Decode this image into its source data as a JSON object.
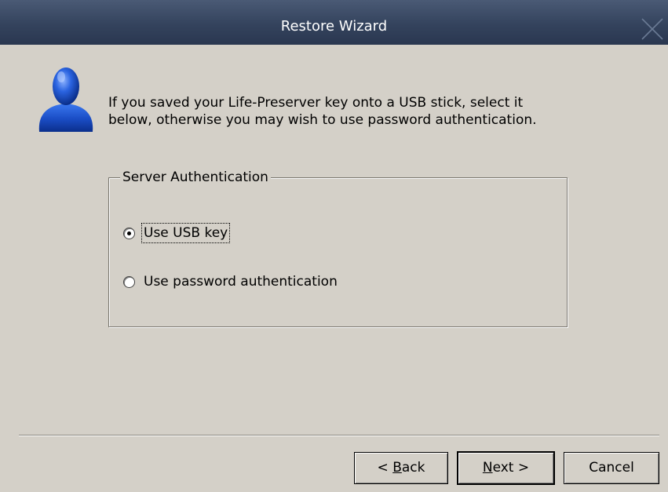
{
  "window": {
    "title": "Restore Wizard"
  },
  "intro": {
    "line1": "If you saved your Life-Preserver key onto a USB stick, select it",
    "line2": "below, otherwise you may wish to use password authentication."
  },
  "group": {
    "legend": "Server Authentication",
    "options": [
      {
        "label": "Use USB key",
        "selected": true
      },
      {
        "label": "Use password authentication",
        "selected": false
      }
    ]
  },
  "buttons": {
    "back_prefix": "< ",
    "back_mnemonic": "B",
    "back_rest": "ack",
    "next_mnemonic": "N",
    "next_rest": "ext >",
    "cancel": "Cancel"
  },
  "icons": {
    "close": "close-icon",
    "user": "user-icon"
  },
  "colors": {
    "titlebar": "#34435d",
    "background": "#d4d0c8",
    "icon_blue": "#1f55c8"
  }
}
